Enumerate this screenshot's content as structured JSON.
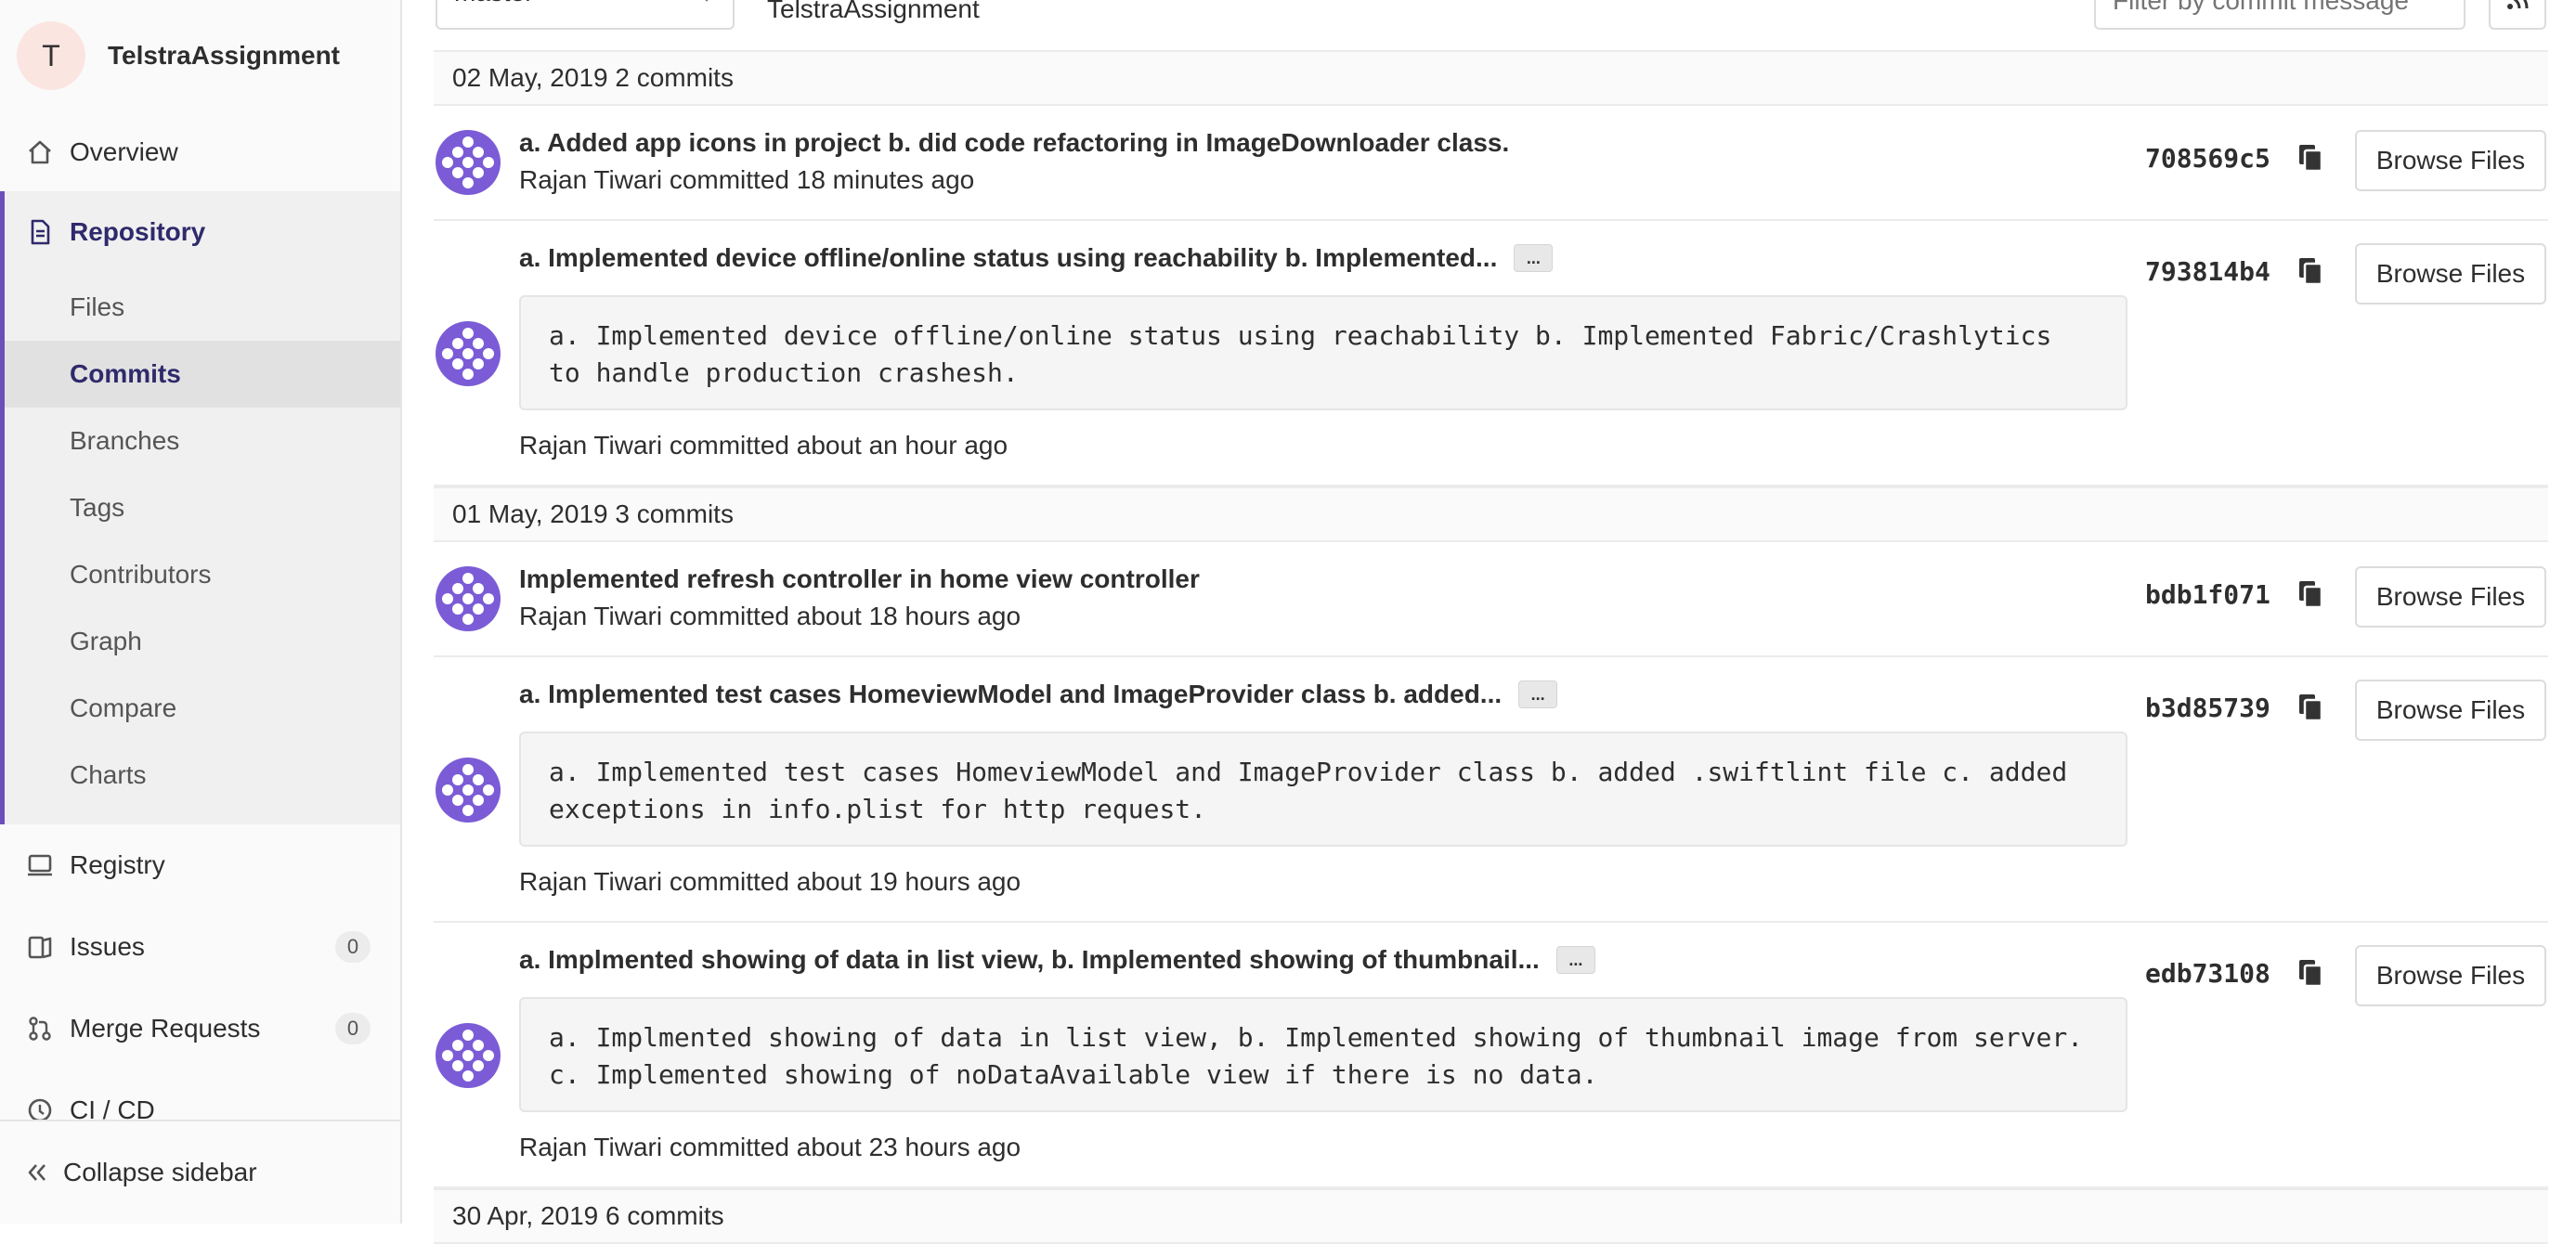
{
  "project": {
    "avatar_letter": "T",
    "name": "TelstraAssignment"
  },
  "sidebar": {
    "overview": "Overview",
    "repository": "Repository",
    "sub_items": [
      "Files",
      "Commits",
      "Branches",
      "Tags",
      "Contributors",
      "Graph",
      "Compare",
      "Charts"
    ],
    "active_sub_item": "Commits",
    "registry": "Registry",
    "issues": {
      "label": "Issues",
      "count": "0"
    },
    "merge_requests": {
      "label": "Merge Requests",
      "count": "0"
    },
    "cicd": "CI / CD",
    "collapse": "Collapse sidebar"
  },
  "toolbar": {
    "branch": "master",
    "path": "TelstraAssignment",
    "filter_placeholder": "Filter by commit message"
  },
  "days": [
    {
      "header": "02 May, 2019 2 commits"
    },
    {
      "header": "01 May, 2019 3 commits"
    },
    {
      "header": "30 Apr, 2019 6 commits"
    }
  ],
  "commits": [
    {
      "title": "a. Added app icons in project b. did code refactoring in ImageDownloader class.",
      "author_line": "Rajan Tiwari committed 18 minutes ago",
      "sha": "708569c5",
      "browse_label": "Browse Files"
    },
    {
      "title": "a. Implemented device offline/online status using reachability b. Implemented...",
      "ellipsis": "...",
      "description": "a. Implemented device offline/online status using reachability b. Implemented Fabric/Crashlytics to handle production crashesh.",
      "author_line": "Rajan Tiwari committed about an hour ago",
      "sha": "793814b4",
      "browse_label": "Browse Files"
    },
    {
      "title": "Implemented refresh controller in home view controller",
      "author_line": "Rajan Tiwari committed about 18 hours ago",
      "sha": "bdb1f071",
      "browse_label": "Browse Files"
    },
    {
      "title": "a. Implemented test cases HomeviewModel and ImageProvider class b. added...",
      "ellipsis": "...",
      "description": "a. Implemented test cases HomeviewModel and ImageProvider class b. added .swiftlint file c. added exceptions in info.plist for http request.",
      "author_line": "Rajan Tiwari committed about 19 hours ago",
      "sha": "b3d85739",
      "browse_label": "Browse Files"
    },
    {
      "title": "a. Implmented showing of data in list view, b. Implemented showing of thumbnail...",
      "ellipsis": "...",
      "description": "a. Implmented showing of data in list view, b. Implemented showing of thumbnail image from server. c. Implemented showing of noDataAvailable view if there is no data.",
      "author_line": "Rajan Tiwari committed about 23 hours ago",
      "sha": "edb73108",
      "browse_label": "Browse Files"
    }
  ],
  "colors": {
    "accent": "#6b4fbb",
    "avatar_bg": "#7b5cd6",
    "repo_text": "#2f2a6b"
  },
  "icons": [
    "home-icon",
    "document-icon",
    "registry-icon",
    "issues-icon",
    "merge-request-icon",
    "cicd-icon",
    "double-chevron-left-icon",
    "copy-icon",
    "rss-icon",
    "chevron-down-icon"
  ]
}
